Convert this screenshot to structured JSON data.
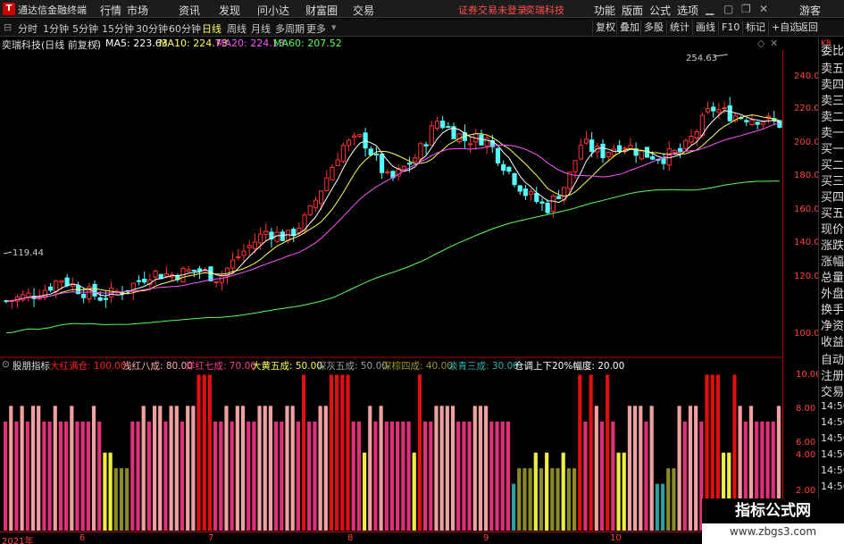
{
  "window": {
    "app_title": "通达信金融终端",
    "menu": [
      "行情",
      "市场",
      "资讯",
      "发现",
      "问小达",
      "财富圈",
      "交易"
    ],
    "notice": "证券交易未登录",
    "stock_name": "奕瑞科技",
    "right_menu": [
      "功能",
      "版面",
      "公式",
      "选项"
    ],
    "user": "游客",
    "colors": {
      "bg": "#000000",
      "up": "#ff3232",
      "down": "#54ffff",
      "accent": "#ffff54"
    }
  },
  "toolbar": {
    "periods": [
      "分时",
      "1分钟",
      "5分钟",
      "15分钟",
      "30分钟",
      "60分钟",
      "日线",
      "周线",
      "月线",
      "多周期",
      "更多"
    ],
    "active_period": "日线",
    "buttons": [
      "复权",
      "叠加",
      "多股",
      "统计",
      "画线",
      "F10",
      "标记",
      "+自选",
      "返回"
    ]
  },
  "chart": {
    "title": "奕瑞科技(日线 前复权)",
    "ma_labels": [
      {
        "label": "MA5: 223.63",
        "color": "#ffffff"
      },
      {
        "label": "MA10: 224.73",
        "color": "#ffff54"
      },
      {
        "label": "MA20: 224.13",
        "color": "#ff54ff"
      },
      {
        "label": "MA60: 207.52",
        "color": "#54ff54"
      }
    ],
    "high_marker": "254.63",
    "low_marker": "119.44",
    "price_ticks": [
      "240.00",
      "220.00",
      "200.00",
      "180.00",
      "160.00",
      "140.00",
      "120.00",
      "100.00"
    ],
    "price_min": 90,
    "price_max": 265
  },
  "indicator": {
    "name": "股朋指标",
    "labels": [
      {
        "text": "大红满仓: 100.00",
        "color": "#ff2020"
      },
      {
        "text": "浅红八成: 80.00",
        "color": "#ffaaaa"
      },
      {
        "text": "洋红七成: 70.00",
        "color": "#ff3c8c"
      },
      {
        "text": "大黄五成: 50.00",
        "color": "#ffff54"
      },
      {
        "text": "深灰五成: 50.00",
        "color": "#a0a0a0"
      },
      {
        "text": "深棕四成: 40.00",
        "color": "#9a9a30"
      },
      {
        "text": "淡青三成: 30.00",
        "color": "#30b0b0"
      },
      {
        "text": "仓调上下20%幅度: 20.00",
        "color": "#ffffff"
      }
    ],
    "ticks": [
      "10.00",
      "8.00",
      "6.00",
      "4.00",
      "2.00"
    ],
    "levels": [
      7,
      8,
      7,
      8,
      7,
      8,
      8,
      7,
      7,
      8,
      7,
      7,
      8,
      7,
      7,
      7,
      8,
      7,
      5,
      5,
      4,
      4,
      4,
      7,
      7,
      8,
      7,
      8,
      8,
      7,
      8,
      8,
      7,
      8,
      8,
      10,
      10,
      10,
      7,
      7,
      8,
      7,
      8,
      8,
      7,
      7,
      8,
      8,
      8,
      7,
      7,
      8,
      8,
      7,
      10,
      7,
      7,
      8,
      8,
      10,
      10,
      10,
      10,
      7,
      7,
      5,
      8,
      7,
      8,
      7,
      7,
      7,
      7,
      7,
      5,
      10,
      7,
      7,
      8,
      8,
      8,
      8,
      7,
      7,
      7,
      8,
      8,
      8,
      7,
      7,
      7,
      7,
      3,
      4,
      4,
      4,
      5,
      4,
      5,
      4,
      4,
      5,
      4,
      4,
      10,
      7,
      10,
      8,
      7,
      10,
      7,
      5,
      5,
      8,
      8,
      8,
      7,
      8,
      3,
      3,
      4,
      4,
      8,
      7,
      8,
      8,
      7,
      10,
      10,
      10,
      5,
      5,
      10,
      8,
      7,
      8,
      7,
      7,
      7,
      7,
      8
    ]
  },
  "right_panel": {
    "code": "KR",
    "items": [
      "委比",
      "卖五",
      "卖四",
      "卖三",
      "卖二",
      "卖一",
      "买一",
      "买二",
      "买三",
      "买四",
      "买五",
      "现价",
      "涨跌",
      "涨幅",
      "总量",
      "外盘",
      "换手",
      "净资",
      "收益",
      "自动",
      "注册",
      "交易"
    ],
    "times": [
      "14:56",
      "14:56",
      "14:56",
      "14:56",
      "14:56",
      "14:56"
    ]
  },
  "date_axis": [
    "2021年",
    "6",
    "7",
    "8",
    "9",
    "10"
  ],
  "watermark": {
    "title": "指标公式网",
    "url": "www.zbgs3.com"
  },
  "chart_data": {
    "type": "candlestick",
    "title": "奕瑞科技(日线 前复权)",
    "ylim": [
      90,
      265
    ],
    "ma": {
      "MA5": 223.63,
      "MA10": 224.73,
      "MA20": 224.13,
      "MA60": 207.52
    },
    "high": 254.63,
    "low": 119.44
  }
}
